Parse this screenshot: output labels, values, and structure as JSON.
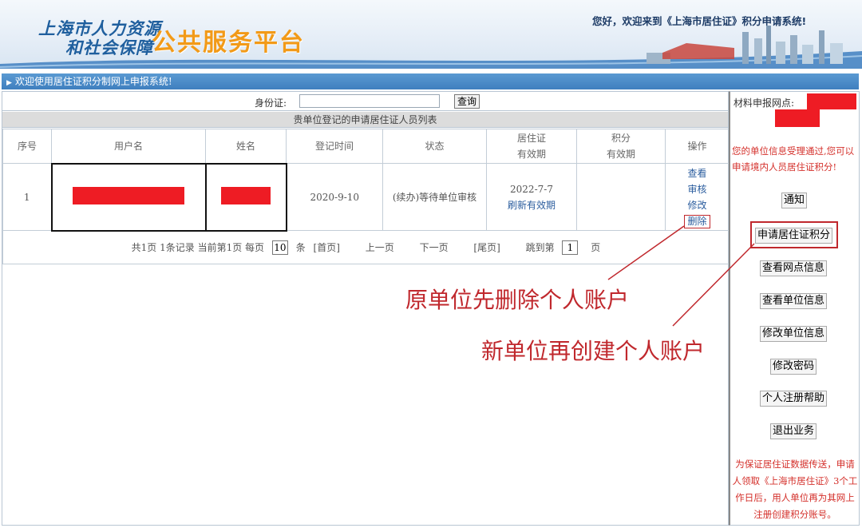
{
  "header": {
    "logo_line1": "上海市人力资源",
    "logo_line2": "和社会保障",
    "logo_main": "公共服务平台",
    "welcome": "您好，欢迎来到《上海市居住证》积分申请系统!"
  },
  "bluebar": {
    "text": "欢迎使用居住证积分制网上申报系统!"
  },
  "search": {
    "label": "身份证:",
    "value": "",
    "button": "查询"
  },
  "list_title": "贵单位登记的申请居住证人员列表",
  "table": {
    "headers": [
      "序号",
      "用户名",
      "姓名",
      "登记时间",
      "状态",
      "居住证",
      "有效期",
      "积分",
      "有效期",
      "操作"
    ],
    "row": {
      "index": "1",
      "register_time": "2020-9-10",
      "status": "(续办)等待单位审核",
      "permit_expiry": "2022-7-7",
      "refresh": "刷新有效期",
      "ops": [
        "查看",
        "审核",
        "修改",
        "删除"
      ]
    }
  },
  "pager": {
    "summary": "共1页 1条记录 当前第1页 每页",
    "per_page": "10",
    "unit": "条",
    "first": "[首页]",
    "prev": "上一页",
    "next": "下一页",
    "last": "[尾页]",
    "jump": "跳到第",
    "page_value": "1",
    "page_unit": "页"
  },
  "sidebar": {
    "label": "材料申报网点:",
    "note": "您的单位信息受理通过,您可以申请境内人员居住证积分!",
    "buttons": [
      "通知",
      "申请居住证积分",
      "查看网点信息",
      "查看单位信息",
      "修改单位信息",
      "修改密码",
      "个人注册帮助",
      "退出业务"
    ],
    "footer": "为保证居住证数据传送，申请人领取《上海市居住证》3个工作日后，用人单位再为其网上注册创建积分账号。"
  },
  "annotations": {
    "line1": "原单位先删除个人账户",
    "line2": "新单位再创建个人账户",
    "color": "#c0282d"
  },
  "colors": {
    "redaction": "#ee1c24",
    "bluebar": "#4a8ac8",
    "brand_orange": "#f29a18",
    "brand_blue": "#1f5f9e"
  }
}
